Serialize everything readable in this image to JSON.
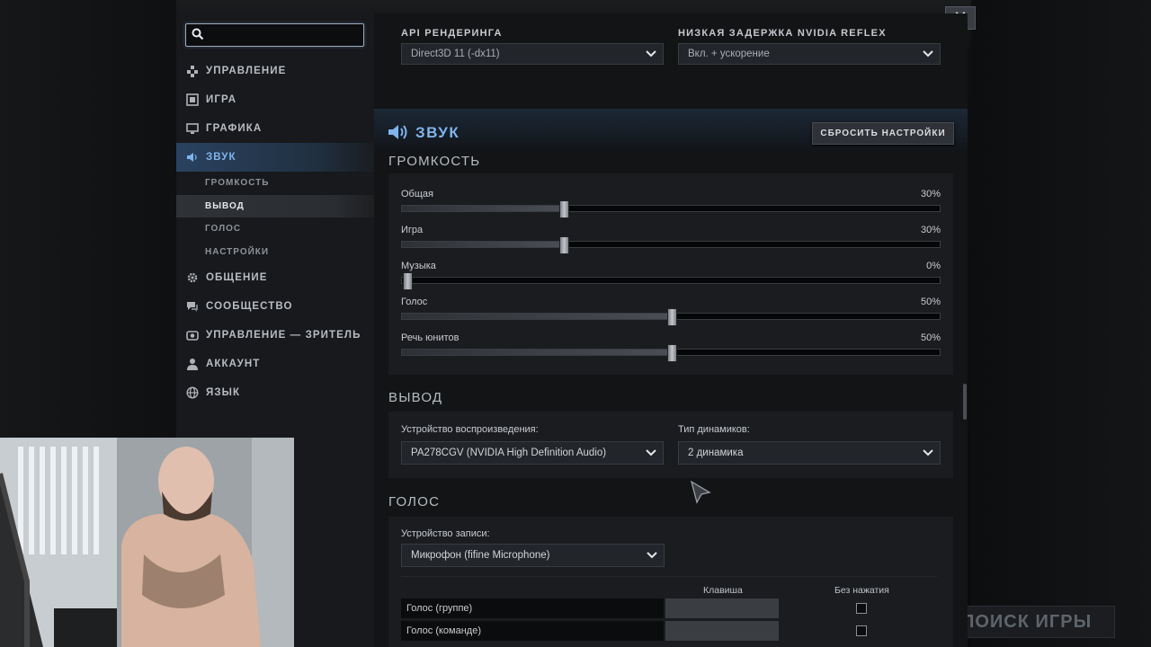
{
  "search": {
    "placeholder": "",
    "value": ""
  },
  "nav": {
    "items": [
      {
        "label": "УПРАВЛЕНИЕ",
        "icon": "controls-icon"
      },
      {
        "label": "ИГРА",
        "icon": "game-icon"
      },
      {
        "label": "ГРАФИКА",
        "icon": "monitor-icon"
      },
      {
        "label": "ЗВУК",
        "icon": "speaker-icon",
        "active": true
      },
      {
        "label": "ОБЩЕНИЕ",
        "icon": "gear-icon"
      },
      {
        "label": "СООБЩЕСТВО",
        "icon": "chat-icon"
      },
      {
        "label": "УПРАВЛЕНИЕ — ЗРИТЕЛЬ",
        "icon": "camera-icon"
      },
      {
        "label": "АККАУНТ",
        "icon": "user-icon"
      },
      {
        "label": "ЯЗЫК",
        "icon": "globe-icon"
      }
    ],
    "sound_sub": [
      {
        "label": "ГРОМКОСТЬ"
      },
      {
        "label": "ВЫВОД",
        "selected": true
      },
      {
        "label": "ГОЛОС"
      },
      {
        "label": "НАСТРОЙКИ"
      }
    ]
  },
  "graphics": {
    "api_label": "API РЕНДЕРИНГА",
    "api_value": "Direct3D 11 (-dx11)",
    "reflex_label": "НИЗКАЯ ЗАДЕРЖКА NVIDIA REFLEX",
    "reflex_value": "Вкл. + ускорение"
  },
  "sound": {
    "title": "ЗВУК",
    "reset_label": "СБРОСИТЬ НАСТРОЙКИ",
    "volume_title": "ГРОМКОСТЬ",
    "sliders": [
      {
        "name": "Общая",
        "pct_label": "30%",
        "value": 0.3
      },
      {
        "name": "Игра",
        "pct_label": "30%",
        "value": 0.3
      },
      {
        "name": "Музыка",
        "pct_label": "0%",
        "value": 0.0
      },
      {
        "name": "Голос",
        "pct_label": "50%",
        "value": 0.5
      },
      {
        "name": "Речь юнитов",
        "pct_label": "50%",
        "value": 0.5
      }
    ],
    "output_title": "ВЫВОД",
    "playback_label": "Устройство воспроизведения:",
    "playback_value": "PA278CGV (NVIDIA High Definition Audio)",
    "speaker_label": "Тип динамиков:",
    "speaker_value": "2 динамика",
    "voice_title": "ГОЛОС",
    "record_label": "Устройство записи:",
    "record_value": "Микрофон (fifine Microphone)",
    "col_key": "Клавиша",
    "col_open": "Без нажатия",
    "bind_rows": [
      {
        "name": "Голос (группе)"
      },
      {
        "name": "Голос (команде)"
      }
    ]
  },
  "background": {
    "search_text": "ПОИСК ИГРЫ"
  },
  "colors": {
    "accent": "#7fb4ec",
    "panel": "#1a1c1f",
    "sidebar": "#17191c"
  }
}
